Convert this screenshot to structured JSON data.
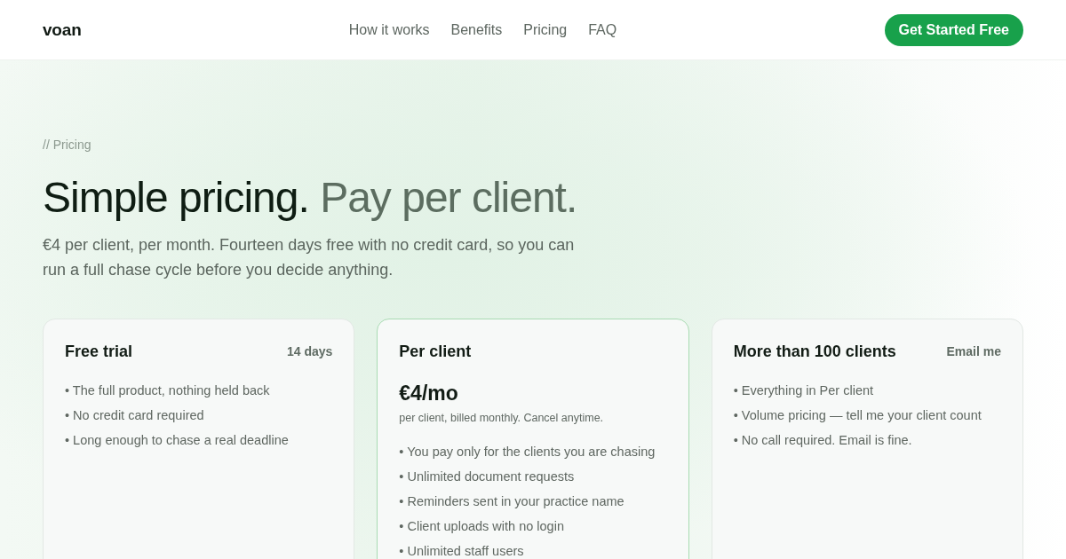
{
  "header": {
    "logo": "voan",
    "nav": [
      "How it works",
      "Benefits",
      "Pricing",
      "FAQ"
    ],
    "cta": "Get Started Free"
  },
  "hero": {
    "eyebrow": "// Pricing",
    "title": "Simple pricing.",
    "title_muted": "Pay per client.",
    "subtitle": "€4 per client, per month. Fourteen days free with no credit card, so you can run a full chase cycle before you decide anything."
  },
  "plans": [
    {
      "name": "Free trial",
      "tag": "14 days",
      "highlighted": false,
      "features": [
        "• The full product, nothing held back",
        "• No credit card required",
        "• Long enough to chase a real deadline"
      ]
    },
    {
      "name": "Per client",
      "highlighted": true,
      "price": "€4/mo",
      "price_note": "per client, billed monthly. Cancel anytime.",
      "features": [
        "• You pay only for the clients you are chasing",
        "• Unlimited document requests",
        "• Reminders sent in your practice name",
        "• Client uploads with no login",
        "• Unlimited staff users"
      ]
    },
    {
      "name": "More than 100 clients",
      "tag": "Email me",
      "highlighted": false,
      "features": [
        "• Everything in Per client",
        "• Volume pricing — tell me your client count",
        "• No call required. Email is fine."
      ]
    }
  ]
}
